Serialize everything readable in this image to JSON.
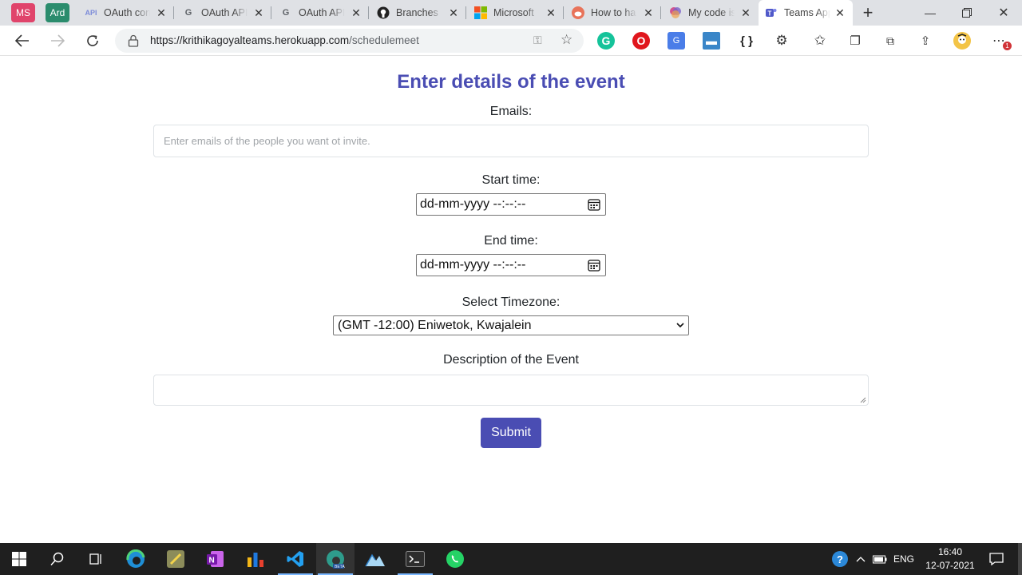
{
  "browser": {
    "workspaces": [
      "MS",
      "Ard"
    ],
    "tabs": [
      {
        "title": "OAuth consent",
        "icon": "api-icon"
      },
      {
        "title": "OAuth API",
        "icon": "google-icon"
      },
      {
        "title": "OAuth API",
        "icon": "google-icon"
      },
      {
        "title": "Branches",
        "icon": "github-icon"
      },
      {
        "title": "Microsoft",
        "icon": "microsoft-icon"
      },
      {
        "title": "How to ha",
        "icon": "reddit-icon"
      },
      {
        "title": "My code is",
        "icon": "colorful-icon"
      },
      {
        "title": "Teams App",
        "icon": "teams-icon",
        "active": true
      }
    ],
    "url_host": "https://krithikagoyalteams.herokuapp.com",
    "url_path": "/schedulemeet",
    "notification_badge": "1"
  },
  "form": {
    "title": "Enter details of the event",
    "emails_label": "Emails:",
    "emails_placeholder": "Enter emails of the people you want ot invite.",
    "emails_value": "",
    "start_label": "Start time:",
    "start_value": "dd-mm-yyyy --:--:--",
    "end_label": "End time:",
    "end_value": "dd-mm-yyyy --:--:--",
    "timezone_label": "Select Timezone:",
    "timezone_selected": "(GMT -12:00) Eniwetok, Kwajalein",
    "description_label": "Description of the Event",
    "description_value": "",
    "submit_label": "Submit"
  },
  "taskbar": {
    "language": "ENG",
    "time": "16:40",
    "date": "12-07-2021"
  },
  "colors": {
    "accent": "#4a4db3"
  }
}
